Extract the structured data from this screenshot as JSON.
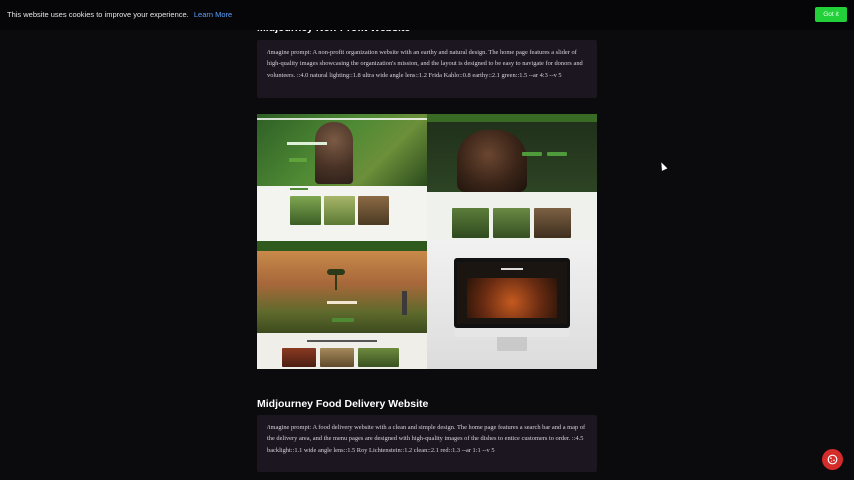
{
  "cookie": {
    "text": "This website uses cookies to improve your experience.",
    "link": "Learn More",
    "button": "Got it"
  },
  "sections": [
    {
      "title": "Midjourney Non-Profit Website",
      "prompt": "/imagine prompt: A non-profit organization website with an earthy and natural design. The home page features a slider of high-quality images showcasing the organization's mission, and the layout is designed to be easy to navigate for donors and volunteers. ::4.0 natural lighting::1.8 ultra wide angle lens::1.2 Frida Kahlo::0.8 earthy::2.1 green::1.5 --ar 4:3 --v 5"
    },
    {
      "title": "Midjourney Food Delivery Website",
      "prompt": "/imagine prompt: A food delivery website with a clean and simple design. The home page features a search bar and a map of the delivery area, and the menu pages are designed with high-quality images of the dishes to entice customers to order. ::4.5 backlight::1.1 wide angle lens::1.5 Roy Lichtenstein::1.2 clean::2.1 red::1.3 --ar 1:1 --v 5"
    }
  ],
  "icons": {
    "fab": "cookie-settings-icon",
    "cursor": "mouse-cursor-icon"
  },
  "colors": {
    "background": "#0b0b0d",
    "prompt_box": "#1c1620",
    "accept_button": "#22d13a",
    "fab": "#d42b2b",
    "link": "#5aa0ff"
  }
}
